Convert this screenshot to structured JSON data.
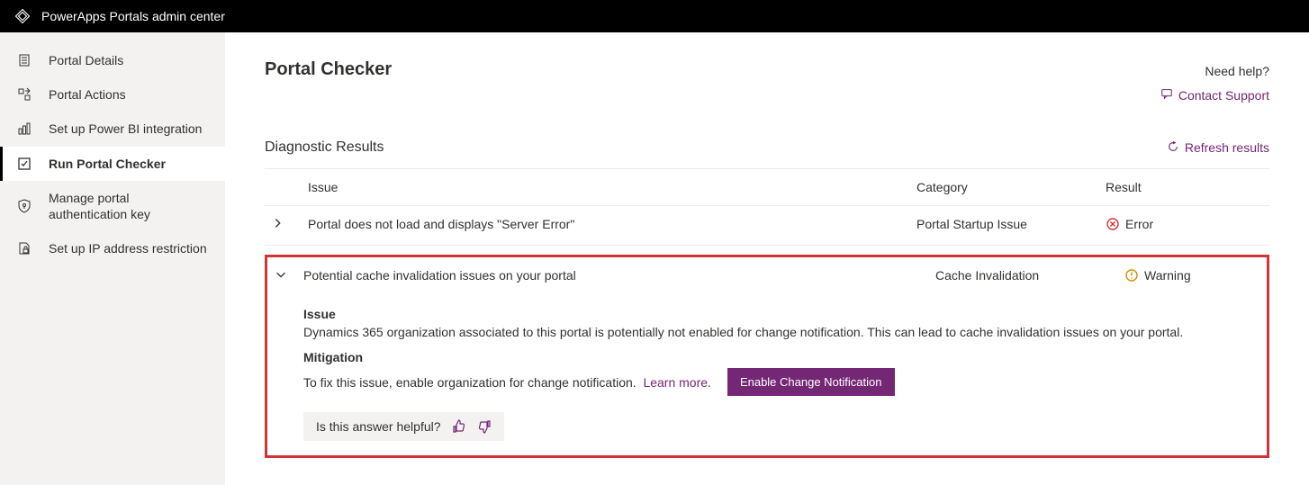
{
  "topbar": {
    "title": "PowerApps Portals admin center"
  },
  "sidebar": {
    "items": [
      {
        "label": "Portal Details"
      },
      {
        "label": "Portal Actions"
      },
      {
        "label": "Set up Power BI integration"
      },
      {
        "label": "Run Portal Checker"
      },
      {
        "label": "Manage portal\nauthentication key"
      },
      {
        "label": "Set up IP address restriction"
      }
    ]
  },
  "page": {
    "title": "Portal Checker",
    "need_help": "Need help?",
    "contact_support": "Contact Support",
    "section_title": "Diagnostic Results",
    "refresh": "Refresh results",
    "columns": {
      "issue": "Issue",
      "category": "Category",
      "result": "Result"
    }
  },
  "rows": [
    {
      "issue": "Portal does not load and displays \"Server Error\"",
      "category": "Portal Startup Issue",
      "result": "Error"
    },
    {
      "issue": "Potential cache invalidation issues on your portal",
      "category": "Cache Invalidation",
      "result": "Warning"
    }
  ],
  "detail": {
    "issue_heading": "Issue",
    "issue_text": "Dynamics 365 organization associated to this portal is potentially not enabled for change notification. This can lead to cache invalidation issues on your portal.",
    "mitigation_heading": "Mitigation",
    "mitigation_text": "To fix this issue, enable organization for change notification.",
    "learn_more": "Learn more",
    "button": "Enable Change Notification",
    "feedback_prompt": "Is this answer helpful?"
  }
}
